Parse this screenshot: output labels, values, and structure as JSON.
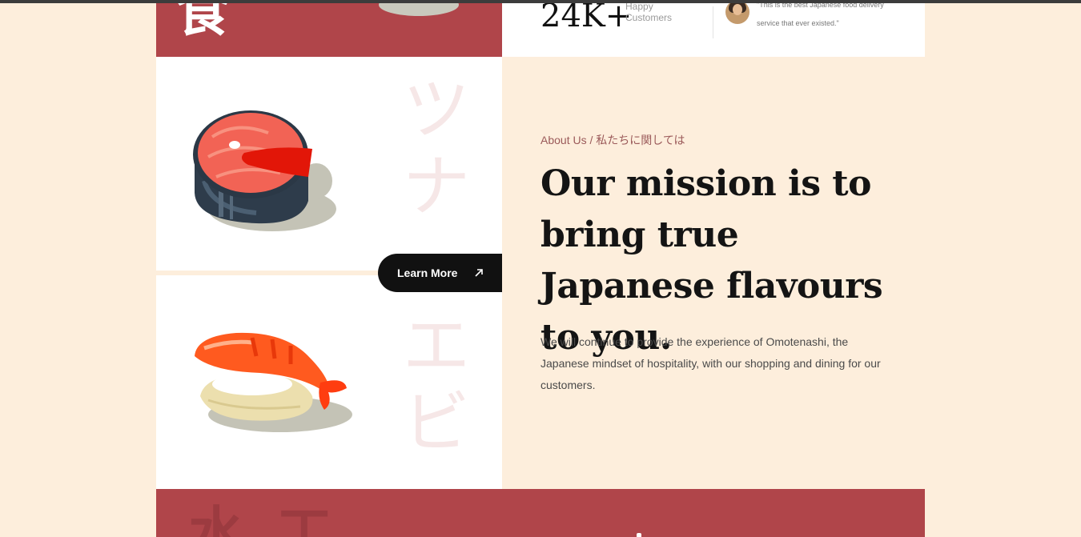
{
  "hero": {
    "kanji": "食"
  },
  "stats": {
    "customers_value": "24K+",
    "customers_label": "Happy Customers",
    "testimonial": "\"This is the best Japanese food delivery service that ever existed.\""
  },
  "cards": [
    {
      "kana": "ツナ",
      "item": "salmon-steak"
    },
    {
      "kana": "エビ",
      "item": "shrimp-nigiri"
    }
  ],
  "learn_more": {
    "label": "Learn More",
    "icon": "arrow-up-right-icon"
  },
  "about": {
    "label": "About Us / 私たちに関しては",
    "headline": "Our mission is to bring true Japanese flavours to you.",
    "description": "We will continue to provide the experience of Omotenashi, the Japanese mindset of hospitality, with our shopping and dining for our customers."
  },
  "footer_band": {
    "kanji": "水工"
  },
  "colors": {
    "page_bg": "#fdeedc",
    "brand_red": "#b0454a",
    "button_dark": "#111111",
    "accent_text": "#9b5a5a",
    "kana_faded": "#f6e7e7"
  }
}
